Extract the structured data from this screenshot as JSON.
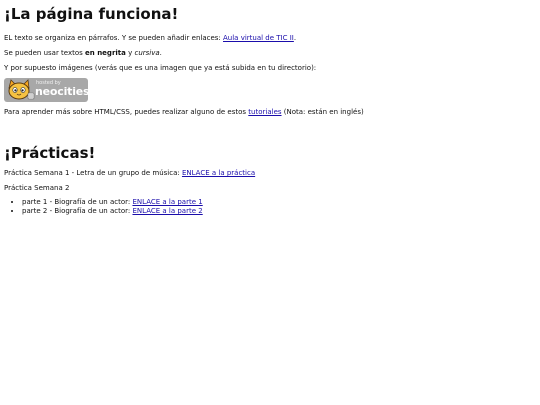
{
  "header": {
    "title": "¡La página funciona!"
  },
  "intro": {
    "text_before_link": "EL texto se organiza en párrafos. Y se pueden añadir enlaces: ",
    "link_label": "Aula virtual de TIC II",
    "text_after_link": "."
  },
  "styles": {
    "text_before_bold": "Se pueden usar textos ",
    "bold_text": "en negrita",
    "text_between": " y ",
    "italic_text": "cursiva",
    "text_after": "."
  },
  "images": {
    "text": "Y por supuesto imágenes (verás que es una imagen que ya está subida en tu directorio):",
    "badge_small_text": "hosted by",
    "badge_brand": "neocities",
    "badge_icon": "neocities-cat-icon"
  },
  "tutorials": {
    "text_before_link": "Para aprender más sobre HTML/CSS, puedes realizar alguno de estos ",
    "link_label": "tutoriales",
    "text_after_link": " (Nota: están en inglés)"
  },
  "practicas": {
    "title": "¡Prácticas!",
    "week1": {
      "text": "Práctica Semana 1 - Letra de un grupo de música: ",
      "link_label": "ENLACE a la práctica"
    },
    "week2": {
      "text": "Práctica Semana 2",
      "items": [
        {
          "text": "parte 1 - Biografía de un actor: ",
          "link_label": "ENLACE a la parte 1"
        },
        {
          "text": "parte 2 - Biografía de un actor: ",
          "link_label": "ENLACE a la parte 2"
        }
      ]
    }
  }
}
